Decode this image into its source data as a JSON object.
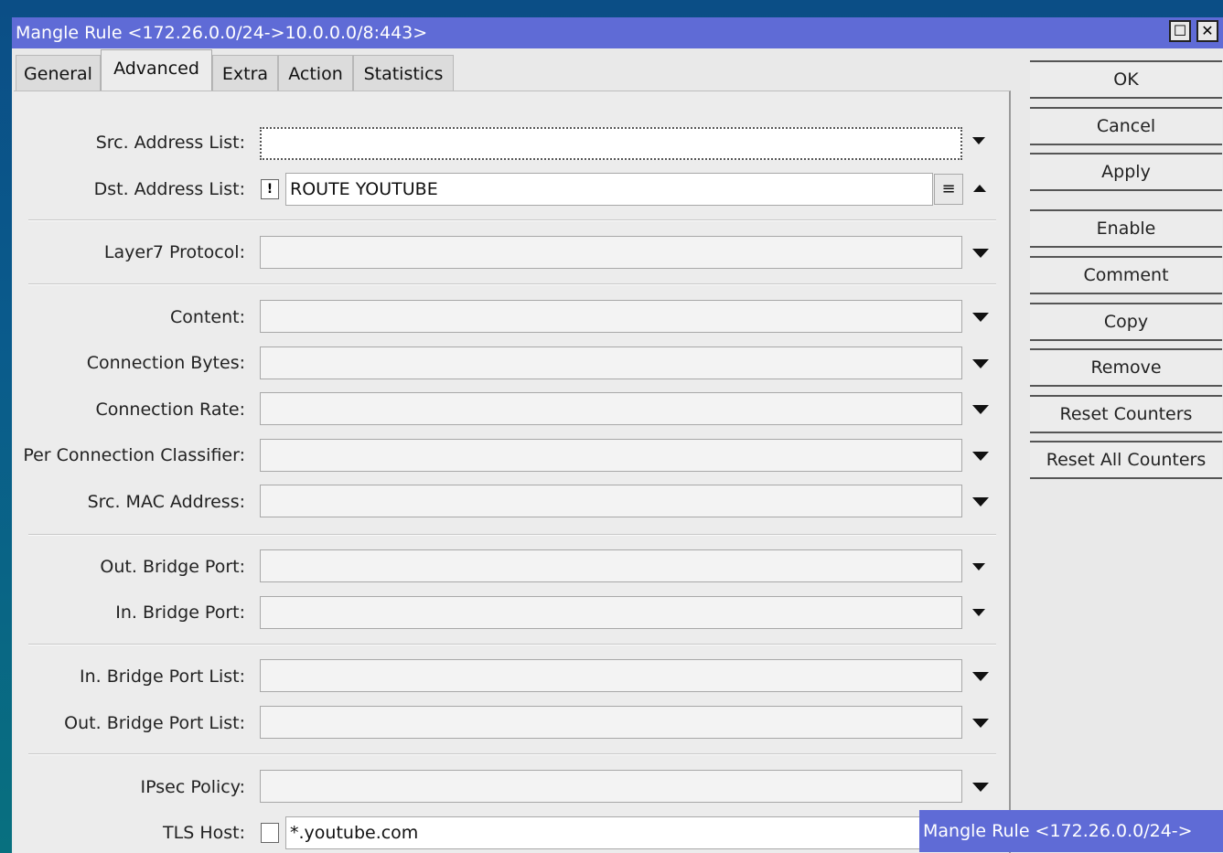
{
  "window": {
    "title": "Mangle Rule <172.26.0.0/24->10.0.0.0/8:443>",
    "btn_maximize": "☐",
    "btn_close": "✕"
  },
  "tabs": [
    "General",
    "Advanced",
    "Extra",
    "Action",
    "Statistics"
  ],
  "active_tab": "Advanced",
  "fields": {
    "src_address_list": {
      "label": "Src. Address List:",
      "value": ""
    },
    "dst_address_list": {
      "label": "Dst. Address List:",
      "negate": "!",
      "value": "ROUTE YOUTUBE"
    },
    "layer7_protocol": {
      "label": "Layer7 Protocol:",
      "value": ""
    },
    "content": {
      "label": "Content:",
      "value": ""
    },
    "connection_bytes": {
      "label": "Connection Bytes:",
      "value": ""
    },
    "connection_rate": {
      "label": "Connection Rate:",
      "value": ""
    },
    "per_connection_classifier": {
      "label": "Per Connection Classifier:",
      "value": ""
    },
    "src_mac_address": {
      "label": "Src. MAC Address:",
      "value": ""
    },
    "out_bridge_port": {
      "label": "Out. Bridge Port:",
      "value": ""
    },
    "in_bridge_port": {
      "label": "In. Bridge Port:",
      "value": ""
    },
    "in_bridge_port_list": {
      "label": "In. Bridge Port List:",
      "value": ""
    },
    "out_bridge_port_list": {
      "label": "Out. Bridge Port List:",
      "value": ""
    },
    "ipsec_policy": {
      "label": "IPsec Policy:",
      "value": ""
    },
    "tls_host": {
      "label": "TLS Host:",
      "value": "*.youtube.com"
    }
  },
  "buttons": [
    "OK",
    "Cancel",
    "Apply",
    "Enable",
    "Comment",
    "Copy",
    "Remove",
    "Reset Counters",
    "Reset All Counters"
  ],
  "taskbar": {
    "title": "Mangle Rule <172.26.0.0/24->"
  }
}
